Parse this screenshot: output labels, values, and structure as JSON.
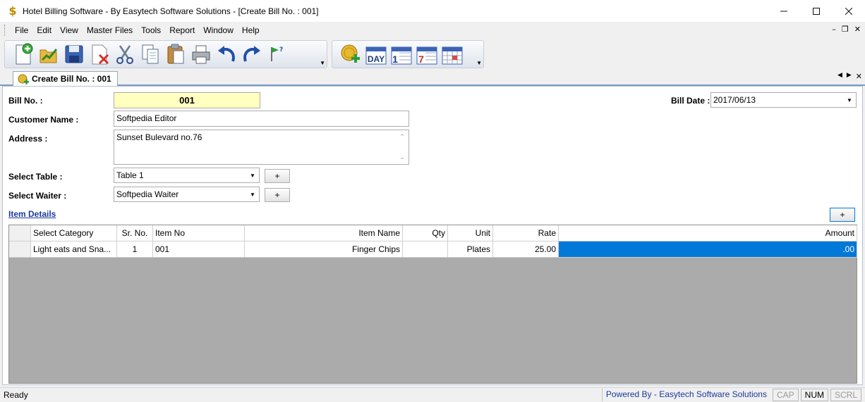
{
  "window": {
    "title": "Hotel Billing Software - By Easytech Software Solutions - [Create Bill No. : 001]",
    "app_icon": "dollar-icon",
    "controls": [
      "minimize-icon",
      "maximize-icon",
      "close-icon"
    ]
  },
  "menu": {
    "items": [
      "File",
      "Edit",
      "View",
      "Master Files",
      "Tools",
      "Report",
      "Window",
      "Help"
    ],
    "mdi_controls": [
      "minimize-icon",
      "restore-icon",
      "close-icon"
    ]
  },
  "toolbar": {
    "group1": [
      "new-document-icon",
      "open-folder-icon",
      "save-icon",
      "delete-icon",
      "cut-icon",
      "copy-icon",
      "paste-icon",
      "print-icon",
      "undo-icon",
      "redo-icon",
      "help-flag-icon"
    ],
    "group2": [
      "add-coin-icon",
      "day-calendar-icon",
      "month-calendar-1-icon",
      "week-calendar-7-icon",
      "calendar-grid-icon"
    ],
    "day_label": "DAY",
    "cal1_label": "1",
    "cal7_label": "7"
  },
  "tab": {
    "label": "Create Bill No. : 001"
  },
  "form": {
    "bill_no_label": "Bill No. :",
    "bill_no_value": "001",
    "bill_date_label": "Bill Date :",
    "bill_date_value": "2017/06/13",
    "customer_name_label": "Customer Name :",
    "customer_name_value": "Softpedia Editor",
    "address_label": "Address :",
    "address_value": "Sunset Bulevard no.76",
    "select_table_label": "Select Table :",
    "select_table_value": "Table 1",
    "select_waiter_label": "Select Waiter :",
    "select_waiter_value": "Softpedia Waiter",
    "plus_label": "+",
    "item_details_label": "Item Details"
  },
  "grid": {
    "headers": [
      "Select Category",
      "Sr. No.",
      "Item No",
      "Item Name",
      "Qty",
      "Unit",
      "Rate",
      "Amount"
    ],
    "rows": [
      [
        "Light eats and Sna...",
        "1",
        "001",
        "Finger Chips",
        "",
        "Plates",
        "25.00",
        ".00"
      ]
    ]
  },
  "status": {
    "left": "Ready",
    "powered": "Powered By - Easytech Software Solutions",
    "cap": "CAP",
    "num": "NUM",
    "scrl": "SCRL"
  },
  "colors": {
    "bill_no_bg": "#ffffc0",
    "selection": "#0078d7",
    "link": "#1a3a9c",
    "grid_bg": "#ababab"
  }
}
